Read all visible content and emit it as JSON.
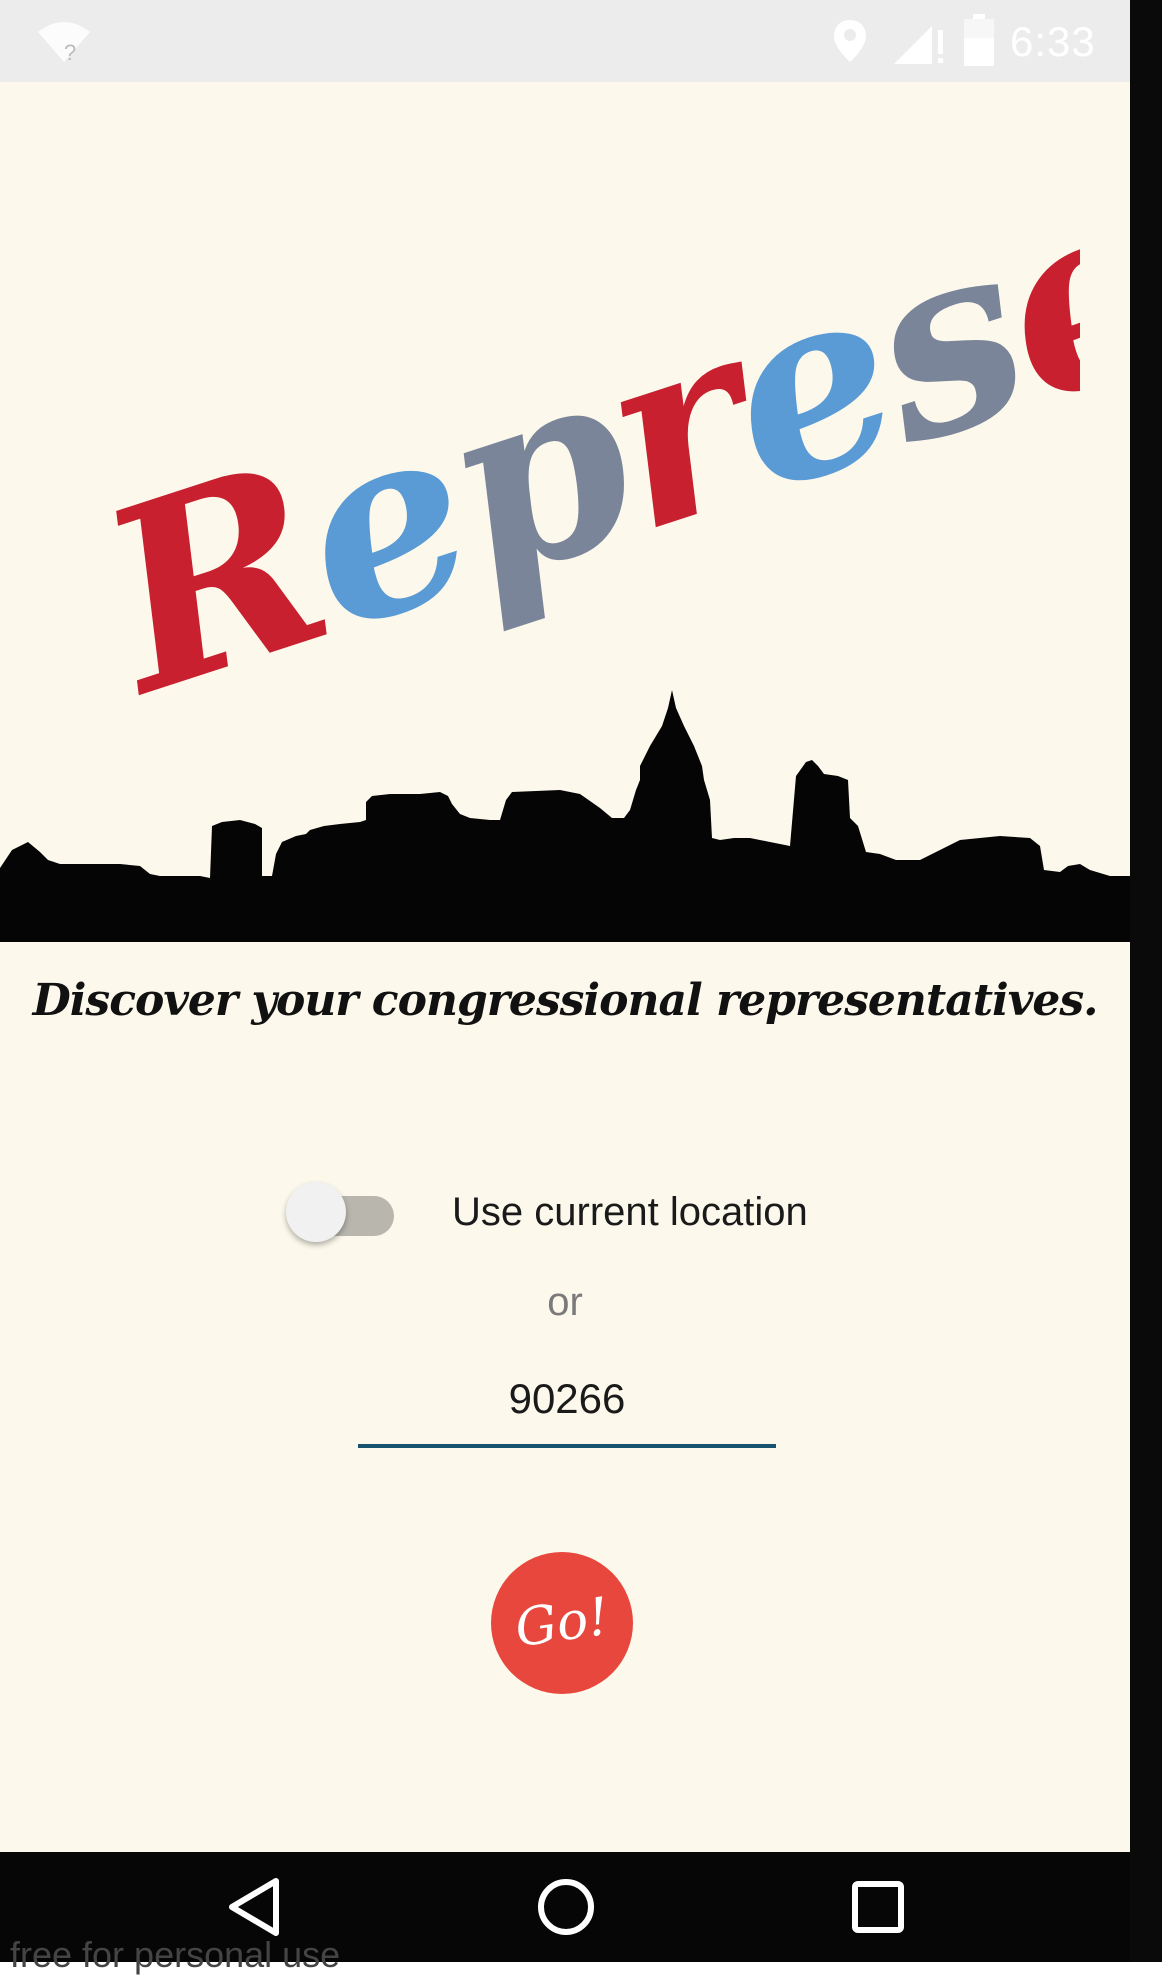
{
  "status_bar": {
    "time": "6:33",
    "icons": [
      "wifi-unknown-icon",
      "location-icon",
      "signal-icon",
      "battery-icon"
    ]
  },
  "logo": {
    "text": "Represent!",
    "colors": [
      "#c8202f",
      "#5a9bd5",
      "#7a8599"
    ]
  },
  "skyline": {
    "icon": "city-skyline-silhouette"
  },
  "tagline": "Discover your congressional representatives.",
  "location_toggle": {
    "label": "Use current location",
    "checked": false
  },
  "or_text": "or",
  "zip_field": {
    "value": "90266"
  },
  "go_button": {
    "label": "Go!",
    "color": "#e8473d"
  },
  "nav_bar": {
    "buttons": [
      "back-icon",
      "home-icon",
      "recents-icon"
    ]
  },
  "watermark": "free for personal use",
  "colors": {
    "background": "#fcf9ec",
    "status_bar": "#ececec",
    "underline": "#17536f"
  }
}
